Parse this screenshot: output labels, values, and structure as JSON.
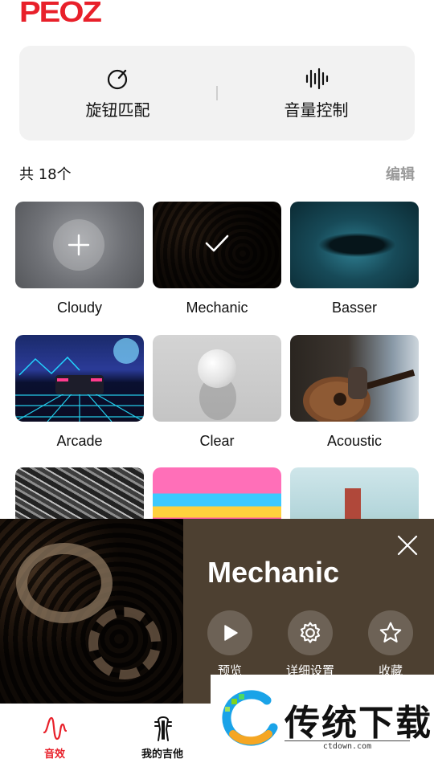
{
  "brand": {
    "logo_text": "PEOZ",
    "color": "#e8202a"
  },
  "tools": [
    {
      "label": "旋钮匹配",
      "icon": "knob-icon"
    },
    {
      "label": "音量控制",
      "icon": "soundwave-icon"
    }
  ],
  "list": {
    "count_text": "共 18个",
    "edit_label": "编辑"
  },
  "presets": [
    {
      "label": "Cloudy",
      "state": "add"
    },
    {
      "label": "Mechanic",
      "state": "selected"
    },
    {
      "label": "Basser"
    },
    {
      "label": "Arcade"
    },
    {
      "label": "Clear"
    },
    {
      "label": "Acoustic"
    },
    {
      "label": ""
    },
    {
      "label": ""
    },
    {
      "label": ""
    }
  ],
  "popup": {
    "title": "Mechanic",
    "actions": [
      {
        "label": "预览",
        "icon": "play-icon"
      },
      {
        "label": "详细设置",
        "icon": "gear-icon"
      },
      {
        "label": "收藏",
        "icon": "star-icon"
      }
    ],
    "panel_color": "#4d4031"
  },
  "tabbar": {
    "tabs": [
      {
        "label": "音效",
        "icon": "wave-icon",
        "active": true,
        "color": "#e8202a"
      },
      {
        "label": "我的吉他",
        "icon": "guitar-head-icon",
        "active": false,
        "color": "#111111"
      }
    ]
  },
  "watermark": {
    "text": "传统下载",
    "url": "ctdown.com"
  }
}
